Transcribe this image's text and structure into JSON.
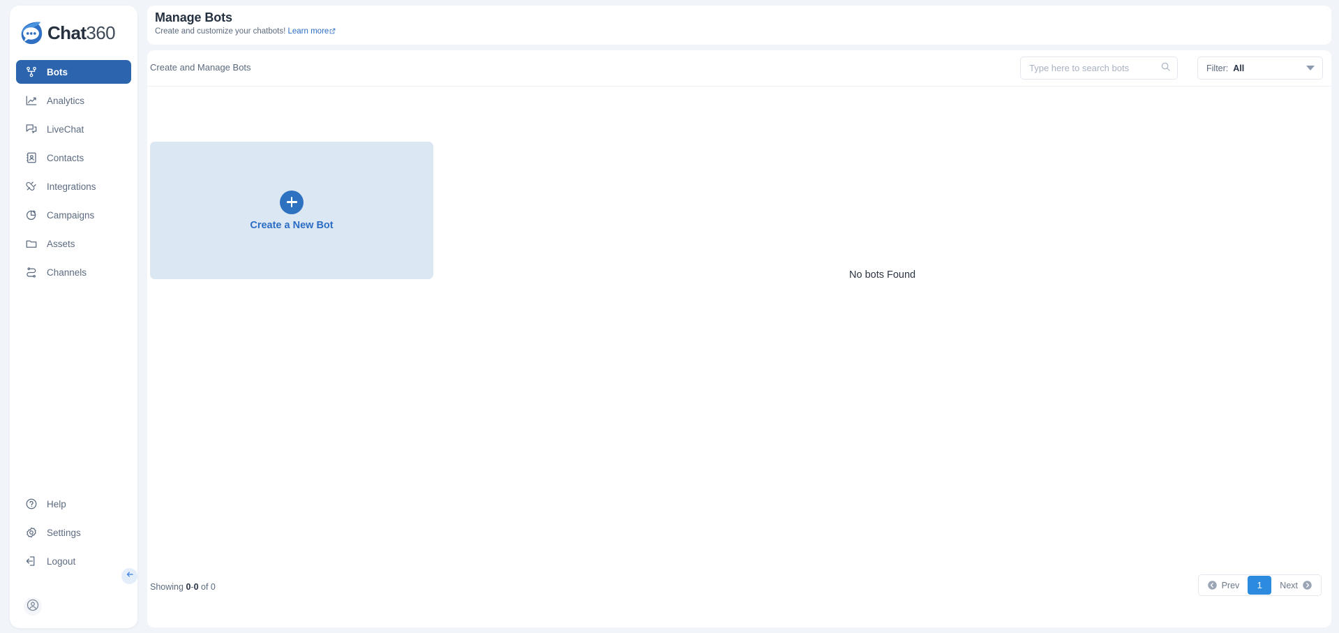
{
  "brand": {
    "logo_text_bold": "Chat",
    "logo_text_light": "360",
    "accent_blue": "#2b6cc4",
    "active_nav_blue": "#2c65ae",
    "page_bg": "#f1f5f9",
    "card_blue": "#dce7f4",
    "pager_active": "#2c8bdf"
  },
  "sidebar": {
    "top_items": [
      {
        "label": "Bots",
        "icon": "bots-icon",
        "active": true
      },
      {
        "label": "Analytics",
        "icon": "analytics-icon",
        "active": false
      },
      {
        "label": "LiveChat",
        "icon": "livechat-icon",
        "active": false
      },
      {
        "label": "Contacts",
        "icon": "contacts-icon",
        "active": false
      },
      {
        "label": "Integrations",
        "icon": "integrations-icon",
        "active": false
      },
      {
        "label": "Campaigns",
        "icon": "campaigns-icon",
        "active": false
      },
      {
        "label": "Assets",
        "icon": "assets-icon",
        "active": false
      },
      {
        "label": "Channels",
        "icon": "channels-icon",
        "active": false
      }
    ],
    "bottom_items": [
      {
        "label": "Help",
        "icon": "help-icon"
      },
      {
        "label": "Settings",
        "icon": "gear-icon"
      },
      {
        "label": "Logout",
        "icon": "logout-icon"
      }
    ],
    "collapse_icon": "chevron-left-icon",
    "avatar_icon": "user-avatar-icon"
  },
  "header": {
    "title": "Manage Bots",
    "subtitle": "Create and customize your chatbots!",
    "link_label": "Learn more",
    "link_icon": "external-link-icon"
  },
  "toolbar": {
    "section_title": "Create and Manage Bots",
    "search": {
      "placeholder": "Type here to search bots",
      "value": "",
      "icon": "search-icon"
    },
    "filter": {
      "label": "Filter:",
      "value": "All",
      "icon": "chevron-down-icon"
    }
  },
  "main": {
    "create_card": {
      "label": "Create a New Bot",
      "icon": "plus-icon"
    },
    "empty_message": "No bots Found"
  },
  "footer": {
    "showing_prefix": "Showing",
    "showing_from": "0",
    "showing_dash": "-",
    "showing_to": "0",
    "showing_mid": "of",
    "showing_total": "0",
    "pagination": {
      "prev_label": "Prev",
      "prev_icon": "arrow-left-circle-icon",
      "current_page": "1",
      "next_label": "Next",
      "next_icon": "arrow-right-circle-icon"
    }
  }
}
